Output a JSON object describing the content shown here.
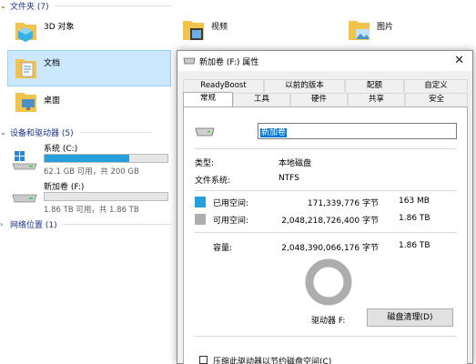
{
  "explorer": {
    "folders_group": "文件夹 (7)",
    "folders": [
      {
        "name": "3D 对象",
        "icon": "3d-objects-folder-icon"
      },
      {
        "name": "视频",
        "icon": "video-folder-icon"
      },
      {
        "name": "图片",
        "icon": "pictures-folder-icon"
      },
      {
        "name": "文档",
        "icon": "documents-folder-icon"
      },
      {
        "name": "桌面",
        "icon": "desktop-folder-icon"
      }
    ],
    "devices_group": "设备和驱动器 (5)",
    "drives": [
      {
        "name": "系统 (C:)",
        "free_text": "62.1 GB 可用，共 200 GB",
        "used_fraction": 0.69
      },
      {
        "name": "新加卷 (F:)",
        "free_text": "1.86 TB 可用，共 1.86 TB",
        "used_fraction": 0.0
      }
    ],
    "network_group": "网络位置 (1)"
  },
  "dialog": {
    "title": "新加卷 (F:) 属性",
    "tabs_row1": [
      "ReadyBoost",
      "以前的版本",
      "配额",
      "自定义"
    ],
    "tabs_row2": [
      "常规",
      "工具",
      "硬件",
      "共享",
      "安全"
    ],
    "active_tab": "常规",
    "volume_name": "新加卷",
    "type_label": "类型:",
    "type_value": "本地磁盘",
    "fs_label": "文件系统:",
    "fs_value": "NTFS",
    "used_label": "已用空间:",
    "used_bytes": "171,339,776 字节",
    "used_size": "163 MB",
    "free_label": "可用空间:",
    "free_bytes": "2,048,218,726,400 字节",
    "free_size": "1.86 TB",
    "capacity_label": "容量:",
    "capacity_bytes": "2,048,390,066,176 字节",
    "capacity_size": "1.86 TB",
    "drive_label": "驱动器 F:",
    "cleanup_button": "磁盘清理(D)",
    "compress_checkbox": "压缩此驱动器以节约磁盘空间(C)",
    "used_color": "#26a0da",
    "free_color": "#adadad"
  }
}
